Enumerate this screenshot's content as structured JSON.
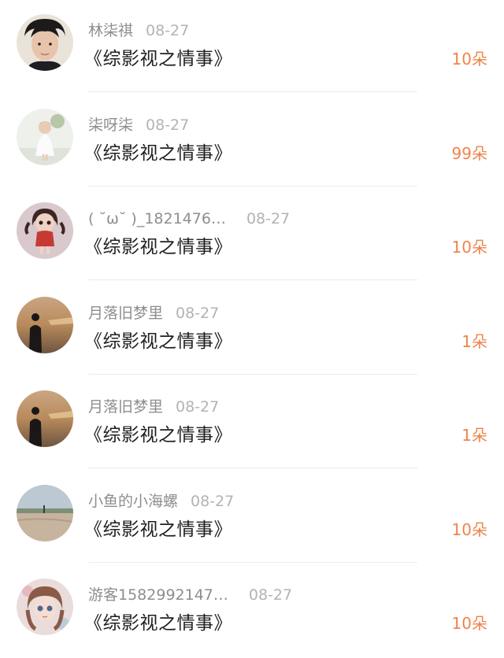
{
  "records": [
    {
      "name": "林柒祺",
      "date": "08-27",
      "title": "《综影视之情事》",
      "gift": "10朵",
      "avatar_icon": "boy-portrait"
    },
    {
      "name": "柒呀柒",
      "date": "08-27",
      "title": "《综影视之情事》",
      "gift": "99朵",
      "avatar_icon": "girl-white-dress"
    },
    {
      "name": "( ˘ω˘ )_1821476…",
      "date": "08-27",
      "title": "《综影视之情事》",
      "gift": "10朵",
      "avatar_icon": "doll-figure"
    },
    {
      "name": "月落旧梦里",
      "date": "08-27",
      "title": "《综影视之情事》",
      "gift": "1朵",
      "avatar_icon": "sunset-silhouette"
    },
    {
      "name": "月落旧梦里",
      "date": "08-27",
      "title": "《综影视之情事》",
      "gift": "1朵",
      "avatar_icon": "sunset-silhouette"
    },
    {
      "name": "小鱼的小海螺",
      "date": "08-27",
      "title": "《综影视之情事》",
      "gift": "10朵",
      "avatar_icon": "beach-landscape"
    },
    {
      "name": "游客1582992147…",
      "date": "08-27",
      "title": "《综影视之情事》",
      "gift": "10朵",
      "avatar_icon": "anime-girl"
    }
  ],
  "colors": {
    "gift": "#f0834a",
    "name": "#8e8e8e",
    "date": "#b3b3b3",
    "title": "#1f1f1f",
    "divider": "#ececec"
  }
}
